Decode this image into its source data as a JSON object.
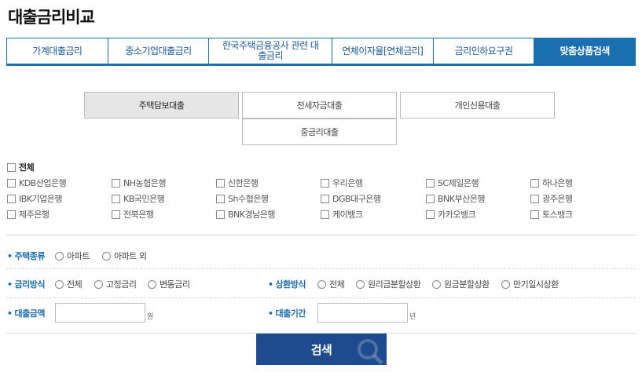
{
  "page": {
    "title": "대출금리비교"
  },
  "main_tabs": [
    {
      "label": "가계대출금리"
    },
    {
      "label": "중소기업대출금리"
    },
    {
      "label": "한국주택금융공사 관련 대출금리"
    },
    {
      "label": "연체이자율[연체금리]"
    },
    {
      "label": "금리인하요구권"
    },
    {
      "label": "맞춤상품검색"
    }
  ],
  "product_tabs": [
    {
      "label": "주택담보대출"
    },
    {
      "label": "전세자금대출"
    },
    {
      "label": "개인신용대출"
    },
    {
      "label": "중금리대출"
    }
  ],
  "banks": {
    "all_label": "전체",
    "items": [
      "KDB산업은행",
      "NH농협은행",
      "신한은행",
      "우리은행",
      "SC제일은행",
      "하나은행",
      "IBK기업은행",
      "KB국민은행",
      "Sh수협은행",
      "DGB대구은행",
      "BNK부산은행",
      "광주은행",
      "제주은행",
      "전북은행",
      "BNK경남은행",
      "케이뱅크",
      "카카오뱅크",
      "토스뱅크"
    ]
  },
  "filters": {
    "house_type": {
      "label": "주택종류",
      "options": [
        "아파트",
        "아파트 외"
      ]
    },
    "rate_type": {
      "label": "금리방식",
      "options": [
        "전체",
        "고정금리",
        "변동금리"
      ]
    },
    "repay_type": {
      "label": "상환방식",
      "options": [
        "전체",
        "원리금분할상환",
        "원금분할상환",
        "만기일시상환"
      ]
    },
    "amount": {
      "label": "대출금액",
      "unit": "원"
    },
    "period": {
      "label": "대출기간",
      "unit": "년"
    }
  },
  "search_button": {
    "label": "검색"
  },
  "colors": {
    "accent": "#1a6fb0",
    "button": "#1d4b8e"
  }
}
